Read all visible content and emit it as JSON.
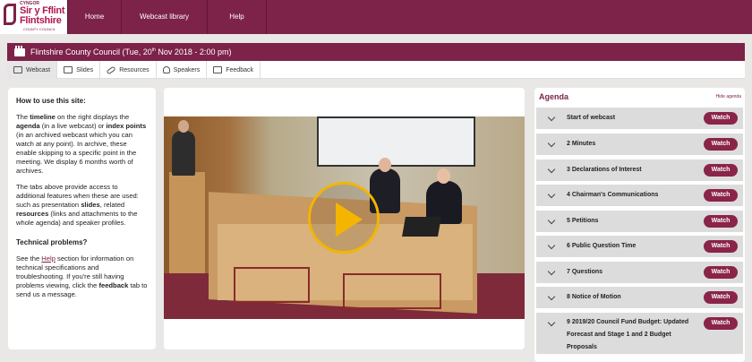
{
  "logo": {
    "line1": "CYNGOR",
    "line2": "Sir y Fflint",
    "line3": "Flintshire",
    "line4": "COUNTY COUNCIL"
  },
  "nav": {
    "home": "Home",
    "library": "Webcast library",
    "help": "Help"
  },
  "title": {
    "text_pre": "Flintshire County Council (Tue, 20",
    "sup": "th",
    "text_post": " Nov 2018 - 2:00 pm)"
  },
  "tabs": [
    {
      "label": "Webcast",
      "icon": "webcast-icon",
      "active": true
    },
    {
      "label": "Slides",
      "icon": "slides-icon"
    },
    {
      "label": "Resources",
      "icon": "link-icon"
    },
    {
      "label": "Speakers",
      "icon": "person-icon"
    },
    {
      "label": "Feedback",
      "icon": "feedback-icon"
    }
  ],
  "help": {
    "heading": "How to use this site:",
    "p1": {
      "a": "The ",
      "b1": "timeline",
      "c": " on the right displays the ",
      "b2": "agenda",
      "d": " (in a live webcast) or ",
      "b3": "index points",
      "e": " (in an archived webcast which you can watch at any point). In archive, these enable skipping to a specific point in the meeting. We display 6 months worth of archives."
    },
    "p2": {
      "a": "The tabs above provide access to additional features when these are used: such as presentation ",
      "b1": "slides",
      "c": ", related ",
      "b2": "resources",
      "d": " (links and attachments to the whole agenda) and speaker profiles."
    },
    "tech_heading": "Technical problems?",
    "p3": {
      "a": "See the ",
      "link": "Help",
      "c": " section for information on technical specifications and troubleshooting. If you're still having problems viewing, click the ",
      "b1": "feedback",
      "d": " tab to send us a message."
    }
  },
  "agenda": {
    "title": "Agenda",
    "hide": "Hide agenda",
    "watch_label": "Watch",
    "items": [
      {
        "label": "Start of webcast"
      },
      {
        "label": "2 Minutes"
      },
      {
        "label": "3 Declarations of Interest"
      },
      {
        "label": "4 Chairman's Communications"
      },
      {
        "label": "5 Petitions"
      },
      {
        "label": "6 Public Question Time"
      },
      {
        "label": "7 Questions"
      },
      {
        "label": "8 Notice of Motion"
      },
      {
        "label": "9 2019/20 Council Fund Budget: Updated Forecast and Stage 1 and 2 Budget Proposals"
      }
    ]
  },
  "colors": {
    "brand": "#7d2248",
    "watch": "#8a2449",
    "play": "#f3b500"
  }
}
